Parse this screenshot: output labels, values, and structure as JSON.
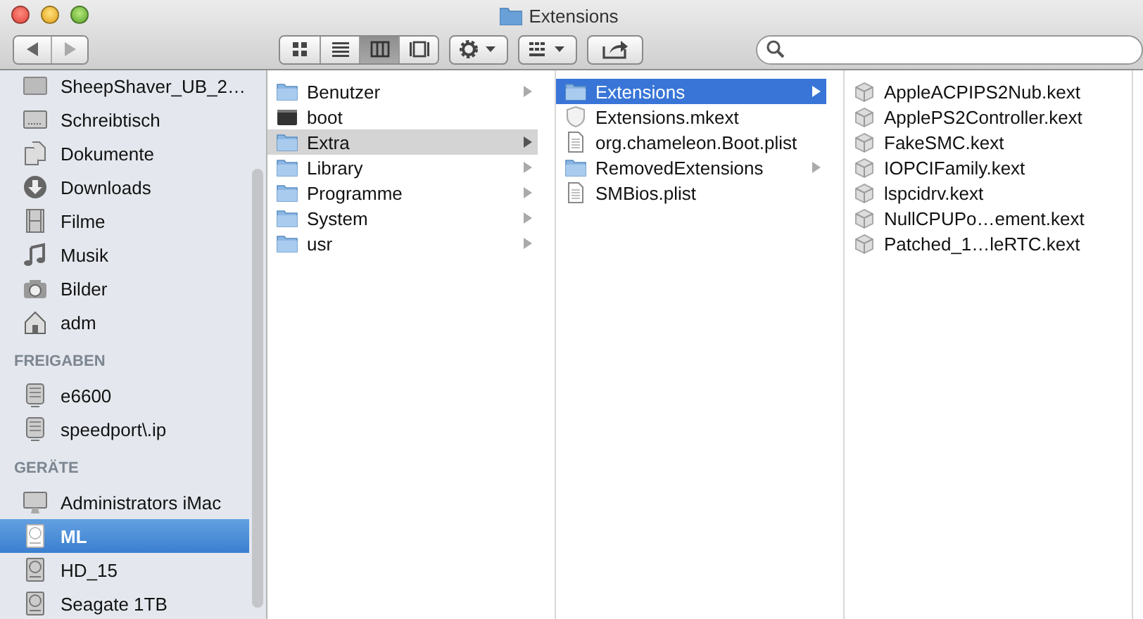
{
  "window": {
    "title": "Extensions"
  },
  "toolbar": {
    "views": [
      {
        "kind": "icons",
        "selected": false
      },
      {
        "kind": "list",
        "selected": false
      },
      {
        "kind": "columns",
        "selected": true
      },
      {
        "kind": "coverflow",
        "selected": false
      }
    ]
  },
  "sidebar": {
    "sections": [
      {
        "items": [
          {
            "label": "SheepShaver_UB_2…",
            "kind": "drive",
            "selected": false
          },
          {
            "label": "Schreibtisch",
            "kind": "desktop",
            "selected": false
          },
          {
            "label": "Dokumente",
            "kind": "documents",
            "selected": false
          },
          {
            "label": "Downloads",
            "kind": "downloads",
            "selected": false
          },
          {
            "label": "Filme",
            "kind": "movies",
            "selected": false
          },
          {
            "label": "Musik",
            "kind": "music",
            "selected": false
          },
          {
            "label": "Bilder",
            "kind": "camera",
            "selected": false
          },
          {
            "label": "adm",
            "kind": "home",
            "selected": false
          }
        ]
      },
      {
        "heading": "FREIGABEN",
        "items": [
          {
            "label": "e6600",
            "kind": "server",
            "selected": false
          },
          {
            "label": "speedport\\.ip",
            "kind": "server",
            "selected": false
          }
        ]
      },
      {
        "heading": "GERÄTE",
        "items": [
          {
            "label": "Administrators iMac",
            "kind": "imac",
            "selected": false
          },
          {
            "label": "ML",
            "kind": "disk",
            "selected": true
          },
          {
            "label": "HD_15",
            "kind": "disk",
            "selected": false
          },
          {
            "label": "Seagate 1TB",
            "kind": "disk",
            "selected": false
          }
        ]
      }
    ]
  },
  "columns": [
    {
      "items": [
        {
          "label": "Benutzer",
          "kind": "folder",
          "expandable": true,
          "selected": false
        },
        {
          "label": "boot",
          "kind": "binary",
          "expandable": false,
          "selected": false
        },
        {
          "label": "Extra",
          "kind": "folder",
          "expandable": true,
          "selected": true,
          "focused": false
        },
        {
          "label": "Library",
          "kind": "folder",
          "expandable": true,
          "selected": false
        },
        {
          "label": "Programme",
          "kind": "folder",
          "expandable": true,
          "selected": false
        },
        {
          "label": "System",
          "kind": "folder",
          "expandable": true,
          "selected": false
        },
        {
          "label": "usr",
          "kind": "folder",
          "expandable": true,
          "selected": false
        }
      ]
    },
    {
      "items": [
        {
          "label": "Extensions",
          "kind": "folder",
          "expandable": true,
          "selected": true,
          "focused": true
        },
        {
          "label": "Extensions.mkext",
          "kind": "shield",
          "expandable": false,
          "selected": false
        },
        {
          "label": "org.chameleon.Boot.plist",
          "kind": "document",
          "expandable": false,
          "selected": false
        },
        {
          "label": "RemovedExtensions",
          "kind": "folder",
          "expandable": true,
          "selected": false
        },
        {
          "label": "SMBios.plist",
          "kind": "document",
          "expandable": false,
          "selected": false
        }
      ]
    },
    {
      "items": [
        {
          "label": "AppleACPIPS2Nub.kext",
          "kind": "kext",
          "expandable": false,
          "selected": false
        },
        {
          "label": "ApplePS2Controller.kext",
          "kind": "kext",
          "expandable": false,
          "selected": false
        },
        {
          "label": "FakeSMC.kext",
          "kind": "kext",
          "expandable": false,
          "selected": false
        },
        {
          "label": "IOPCIFamily.kext",
          "kind": "kext",
          "expandable": false,
          "selected": false
        },
        {
          "label": "lspcidrv.kext",
          "kind": "kext",
          "expandable": false,
          "selected": false
        },
        {
          "label": "NullCPUPo…ement.kext",
          "kind": "kext",
          "expandable": false,
          "selected": false
        },
        {
          "label": "Patched_1…leRTC.kext",
          "kind": "kext",
          "expandable": false,
          "selected": false
        }
      ]
    }
  ]
}
